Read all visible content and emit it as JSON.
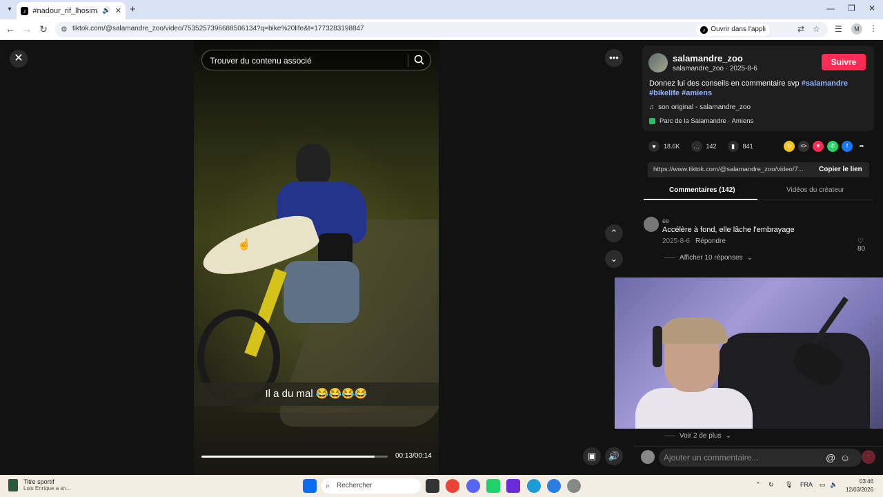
{
  "browser": {
    "tab_title": "#nadour_rif_lhosima #imzo",
    "url": "tiktok.com/@salamandre_zoo/video/7535257396688506134?q=bike%20life&t=1773283198847",
    "open_in_app": "Ouvrir dans l'appli",
    "profile_initial": "M"
  },
  "player": {
    "search_placeholder": "Trouver du contenu associé",
    "subtitle": "Il a du mal 😂😂😂😂",
    "time": "00:13/00:14",
    "progress": 0.93
  },
  "author": {
    "name": "salamandre_zoo",
    "sub": "salamandre_zoo · 2025-8-6",
    "follow_label": "Suivre",
    "description": "Donnez lui des conseils en commentaire svp",
    "hashtags": [
      "#salamandre",
      "#bikelife",
      "#amiens"
    ],
    "music": "son original - salamandre_zoo",
    "location": "Parc de la Salamandre · Amiens"
  },
  "stats": {
    "likes": "18.6K",
    "comments": "142",
    "saves": "841"
  },
  "share": {
    "link": "https://www.tiktok.com/@salamandre_zoo/video/7...",
    "copy_label": "Copier le lien"
  },
  "tabs": {
    "comments": "Commentaires (142)",
    "creator_videos": "Vidéos du créateur"
  },
  "comment": {
    "user": "ee",
    "text": "Accélère à fond, elle lâche l'embrayage",
    "date": "2025-8-6",
    "reply_label": "Répondre",
    "likes": "80",
    "show_replies": "Afficher 10 réponses"
  },
  "see_more": "Voir 2 de plus",
  "comment_input_placeholder": "Ajouter un commentaire...",
  "taskbar": {
    "widget_title": "Titre sportif",
    "widget_sub": "Luis Enrique a sn...",
    "search_label": "Rechercher",
    "lang": "FRA",
    "time": "03:46",
    "date": "12/03/2026"
  },
  "colors": {
    "follow": "#fe2c55",
    "hashtag": "#8fb4ff",
    "accent_bg": "#121212"
  }
}
